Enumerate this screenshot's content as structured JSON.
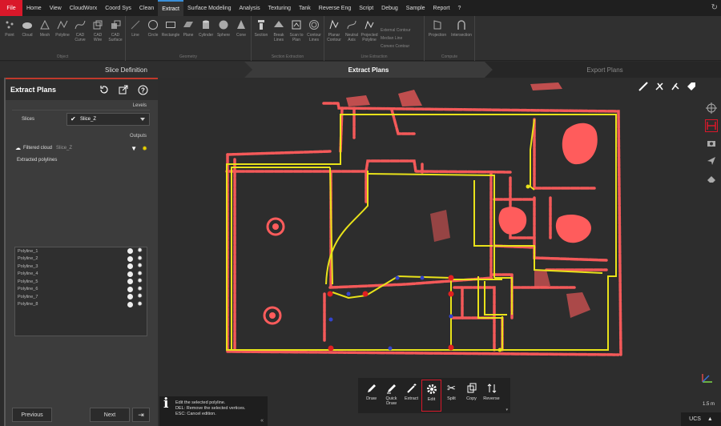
{
  "menu": {
    "file": "File",
    "items": [
      "Home",
      "View",
      "CloudWorx",
      "Coord Sys",
      "Clean",
      "Extract",
      "Surface Modeling",
      "Analysis",
      "Texturing",
      "Tank",
      "Reverse Eng",
      "Script",
      "Debug",
      "Sample",
      "Report",
      "?"
    ],
    "active": "Extract"
  },
  "ribbon": {
    "groups": [
      {
        "name": "Object",
        "buttons": [
          "Point",
          "Cloud",
          "Mesh",
          "Polyline",
          "CAD Curve",
          "CAD Wire",
          "CAD Surface"
        ]
      },
      {
        "name": "Geometry",
        "buttons": [
          "Line",
          "Circle",
          "Rectangle",
          "Plane",
          "Cylinder",
          "Sphere",
          "Cone"
        ]
      },
      {
        "name": "Section Extraction",
        "buttons": [
          "Section",
          "Break Lines",
          "Scan to Plan",
          "Contour Lines"
        ]
      },
      {
        "name": "Line Extraction",
        "buttons": [
          "Planar Contour",
          "Neutral Axis",
          "Projected Polyline"
        ],
        "small": [
          "External Contour",
          "Median Line",
          "Convex Contour"
        ]
      },
      {
        "name": "Compute",
        "buttons": [
          "Projection",
          "Intersection"
        ]
      }
    ]
  },
  "workflow": {
    "steps": [
      "Slice Definition",
      "Extract Plans",
      "Export Plans"
    ],
    "active": "Extract Plans"
  },
  "panel": {
    "title": "Extract Plans",
    "levels_label": "Levels",
    "slices_label": "Slices",
    "slices_value": "Slice_Z",
    "outputs_label": "Outputs",
    "filtered_cloud_label": "Filtered cloud",
    "filtered_cloud_value": "Slice_Z",
    "extracted_label": "Extracted polylines",
    "polylines": [
      "Polyline_1",
      "Polyline_2",
      "Polyline_3",
      "Polyline_4",
      "Polyline_5",
      "Polyline_6",
      "Polyline_7",
      "Polyline_8"
    ],
    "previous": "Previous",
    "next": "Next"
  },
  "toolbar": {
    "buttons": [
      "Draw",
      "Quick Draw",
      "Extract",
      "Edit",
      "Split",
      "Copy",
      "Reverse"
    ],
    "active": "Edit"
  },
  "hint": {
    "line1": "Edit the selected polyline.",
    "line2": "DEL: Remove the selected vertices.",
    "line3": "ESC: Cancel edition."
  },
  "scale": "1.5 m",
  "ucs": "UCS",
  "colors": {
    "accent": "#d9182a",
    "scan": "#ff5c5c",
    "polyline": "#e8e21a",
    "background": "#2d2d2d"
  }
}
